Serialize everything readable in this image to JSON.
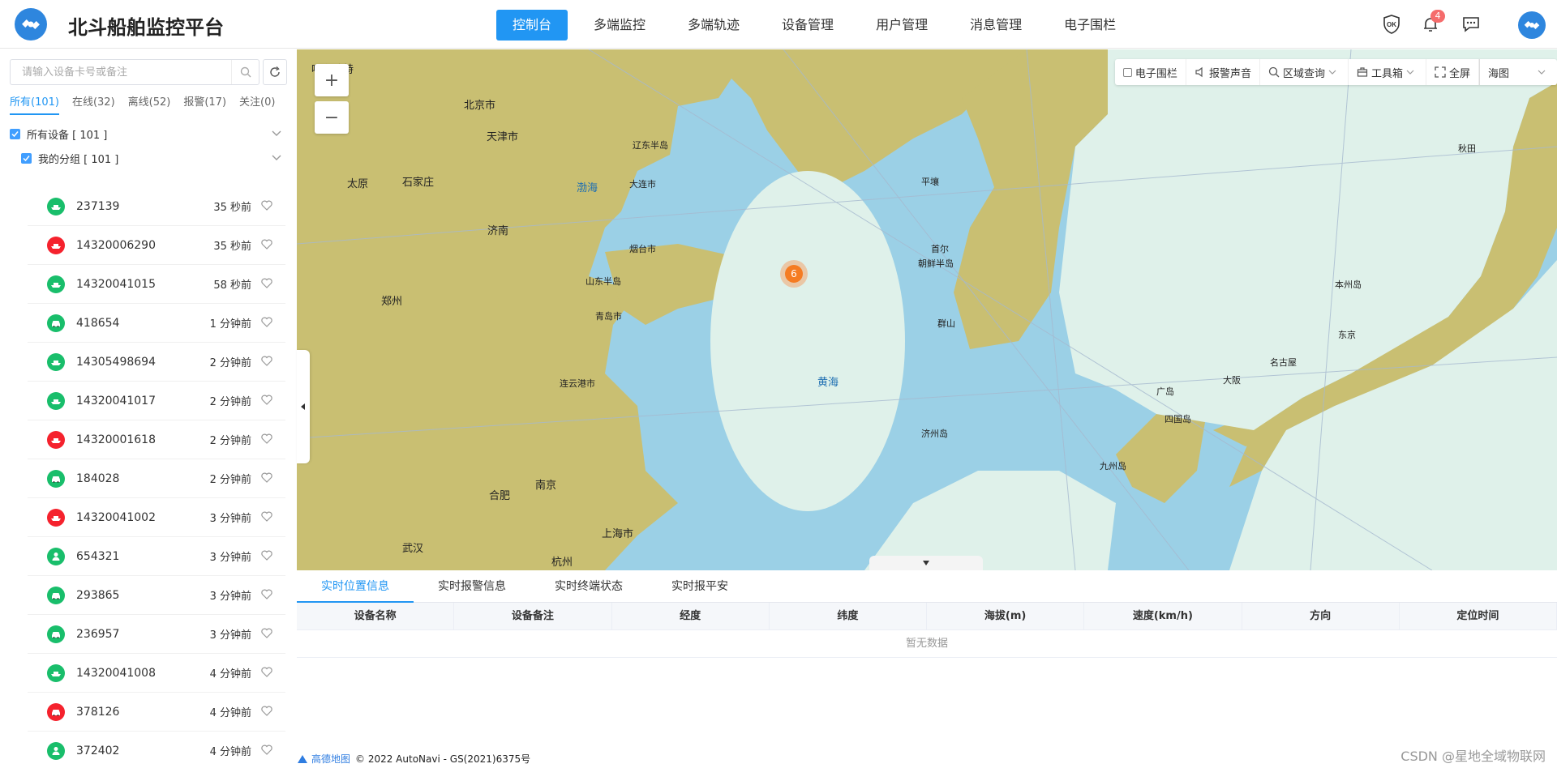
{
  "app": {
    "title": "北斗船舶监控平台"
  },
  "nav": {
    "items": [
      {
        "label": "控制台",
        "active": true
      },
      {
        "label": "多端监控"
      },
      {
        "label": "多端轨迹"
      },
      {
        "label": "设备管理"
      },
      {
        "label": "用户管理"
      },
      {
        "label": "消息管理"
      },
      {
        "label": "电子围栏"
      }
    ]
  },
  "header_icons": {
    "ok_label": "OK",
    "notification_count": "4"
  },
  "sidebar": {
    "search_placeholder": "请输入设备卡号或备注",
    "filters": [
      {
        "label": "所有(101)",
        "active": true
      },
      {
        "label": "在线(32)"
      },
      {
        "label": "离线(52)"
      },
      {
        "label": "报警(17)"
      },
      {
        "label": "关注(0)"
      }
    ],
    "tree": {
      "all_devices": "所有设备 [ 101 ]",
      "my_group": "我的分组 [ 101 ]"
    },
    "devices": [
      {
        "name": "237139",
        "time": "35 秒前",
        "status": "online",
        "icon": "ship-icon"
      },
      {
        "name": "14320006290",
        "time": "35 秒前",
        "status": "alarm",
        "icon": "ship-icon"
      },
      {
        "name": "14320041015",
        "time": "58 秒前",
        "status": "online",
        "icon": "ship-icon"
      },
      {
        "name": "418654",
        "time": "1 分钟前",
        "status": "online",
        "icon": "car-icon"
      },
      {
        "name": "14305498694",
        "time": "2 分钟前",
        "status": "online",
        "icon": "ship-icon"
      },
      {
        "name": "14320041017",
        "time": "2 分钟前",
        "status": "online",
        "icon": "ship-icon"
      },
      {
        "name": "14320001618",
        "time": "2 分钟前",
        "status": "alarm",
        "icon": "ship-icon"
      },
      {
        "name": "184028",
        "time": "2 分钟前",
        "status": "online",
        "icon": "car-icon"
      },
      {
        "name": "14320041002",
        "time": "3 分钟前",
        "status": "alarm",
        "icon": "ship-icon"
      },
      {
        "name": "654321",
        "time": "3 分钟前",
        "status": "online",
        "icon": "person-icon"
      },
      {
        "name": "293865",
        "time": "3 分钟前",
        "status": "online",
        "icon": "car-icon"
      },
      {
        "name": "236957",
        "time": "3 分钟前",
        "status": "online",
        "icon": "car-icon"
      },
      {
        "name": "14320041008",
        "time": "4 分钟前",
        "status": "online",
        "icon": "ship-icon"
      },
      {
        "name": "378126",
        "time": "4 分钟前",
        "status": "alarm",
        "icon": "car-icon"
      },
      {
        "name": "372402",
        "time": "4 分钟前",
        "status": "online",
        "icon": "person-icon"
      }
    ]
  },
  "map": {
    "toolbar": {
      "fence": "电子围栏",
      "alarm_sound": "报警声音",
      "area_query": "区域查询",
      "toolbox": "工具箱",
      "fullscreen": "全屏",
      "map_type": "海图"
    },
    "cluster_count": "6",
    "labels": {
      "beijing": "北京市",
      "tianjin": "天津市",
      "dalian": "大连市",
      "yantai": "烟台市",
      "qingdao": "青岛市",
      "jinan": "济南",
      "taiyuan": "太原",
      "shijiazhuang": "石家庄",
      "zhengzhou": "郑州",
      "nanjing": "南京",
      "shanghai": "上海市",
      "hangzhou": "杭州",
      "hefei": "合肥",
      "wuhan": "武汉",
      "lianyungang": "连云港市",
      "huhehaote": "呼和浩特",
      "bohai": "渤海",
      "yellow_sea": "黄海",
      "shandong_peninsula": "山东半岛",
      "liaodong_peninsula": "辽东半岛",
      "seoul": "首尔",
      "korea": "朝鲜半岛",
      "pyongyang": "平壤",
      "tokyo": "东京",
      "osaka": "大阪",
      "nagoya": "名古屋",
      "hiroshima": "广岛",
      "shikoku": "四国岛",
      "kyushu": "九州岛",
      "honshu": "本州岛",
      "akita": "秋田",
      "jeju": "济州岛",
      "gunsan": "群山"
    },
    "attribution": "© 2022 AutoNavi - GS(2021)6375号",
    "attribution_brand": "高德地图"
  },
  "bottom": {
    "tabs": [
      {
        "label": "实时位置信息",
        "active": true
      },
      {
        "label": "实时报警信息"
      },
      {
        "label": "实时终端状态"
      },
      {
        "label": "实时报平安"
      }
    ],
    "columns": [
      "设备名称",
      "设备备注",
      "经度",
      "纬度",
      "海拔(m)",
      "速度(km/h)",
      "方向",
      "定位时间"
    ],
    "empty_text": "暂无数据"
  },
  "watermark": "CSDN @星地全域物联网",
  "colors": {
    "primary": "#2196f3",
    "online": "#19be6b",
    "alarm": "#f5222d",
    "land": "#c7bd72",
    "sea": "#7fbfe3",
    "shallow": "#dff1ea"
  }
}
